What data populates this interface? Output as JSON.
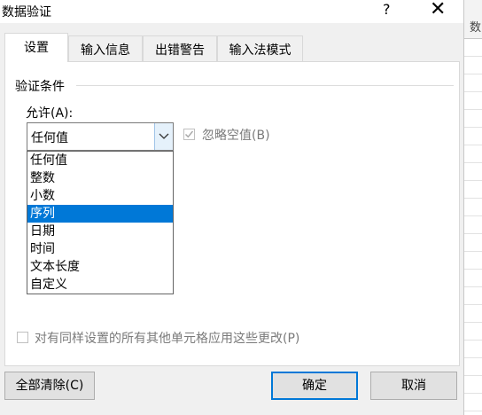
{
  "window": {
    "title": "数据验证",
    "help": "?",
    "close": "✕"
  },
  "backdrop": {
    "column_header": "数"
  },
  "tabs": [
    {
      "label": "设置"
    },
    {
      "label": "输入信息"
    },
    {
      "label": "出错警告"
    },
    {
      "label": "输入法模式"
    }
  ],
  "settings": {
    "group_label": "验证条件",
    "allow_label": "允许(A):",
    "allow_value": "任何值",
    "allow_options": [
      "任何值",
      "整数",
      "小数",
      "序列",
      "日期",
      "时间",
      "文本长度",
      "自定义"
    ],
    "highlighted_option": "序列",
    "ignore_blank_label": "忽略空值(B)",
    "ignore_blank_checked": true,
    "apply_all_label": "对有同样设置的所有其他单元格应用这些更改(P)",
    "apply_all_checked": false
  },
  "buttons": {
    "clear_all": "全部清除(C)",
    "ok": "确定",
    "cancel": "取消"
  },
  "colors": {
    "accent": "#0078d7",
    "disabled_text": "#7a7a7a"
  }
}
